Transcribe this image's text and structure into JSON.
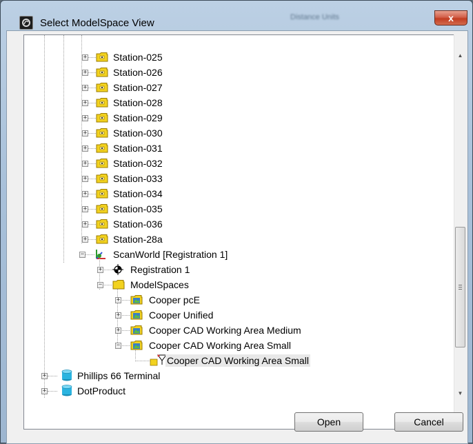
{
  "window": {
    "title": "Select ModelSpace View",
    "background_title": "Distance Units",
    "close_glyph": "x"
  },
  "tree": {
    "stations": [
      "Station-025",
      "Station-026",
      "Station-027",
      "Station-028",
      "Station-029",
      "Station-030",
      "Station-031",
      "Station-032",
      "Station-033",
      "Station-034",
      "Station-035",
      "Station-036",
      "Station-28a"
    ],
    "scanworld_label": "ScanWorld [Registration 1]",
    "registration_label": "Registration 1",
    "modelspaces_label": "ModelSpaces",
    "modelspaces": [
      "Cooper pcE",
      "Cooper Unified",
      "Cooper CAD Working Area Medium",
      "Cooper CAD Working Area Small"
    ],
    "view_label": "Cooper CAD Working Area Small",
    "projects": [
      "Phillips 66 Terminal",
      "DotProduct"
    ],
    "expand_glyph": "+",
    "collapse_glyph": "−"
  },
  "buttons": {
    "open_label": "Open",
    "cancel_label": "Cancel"
  },
  "colors": {
    "folder": "#f2d21f",
    "folder_outline": "#9a7b00",
    "project_db": "#2bb4e0",
    "scanworld_accent": "#2e9b2e"
  }
}
